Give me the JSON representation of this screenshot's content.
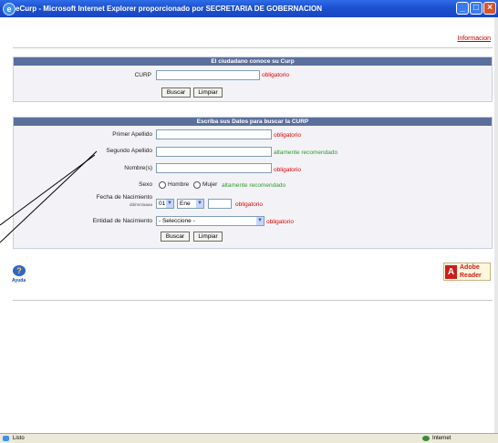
{
  "window": {
    "title": "eCurp - Microsoft Internet Explorer proporcionado por SECRETARIA DE GOBERNACION",
    "minimize": "_",
    "maximize": "□",
    "close": "×"
  },
  "header_link": "Informacion",
  "section1": {
    "title": "El ciudadano conoce su Curp",
    "curp_label": "CURP",
    "curp_value": "",
    "curp_note": "obligatorio",
    "search_button": "Buscar",
    "clear_button": "Limpiar"
  },
  "section2": {
    "title": "Escriba sus Datos para buscar la CURP",
    "first_surname_label": "Primer Apellido",
    "first_surname_note": "obligatorio",
    "second_surname_label": "Segundo Apellido",
    "second_surname_note": "altamente recomendado",
    "names_label": "Nombre(s)",
    "names_note": "obligatorio",
    "sex_label": "Sexo",
    "sex_options": [
      "Hombre",
      "Mujer"
    ],
    "sex_note": "altamente recomendado",
    "birthdate_label": "Fecha de Nacimiento",
    "birthdate_format": "dd/mm/aaaa",
    "day_value": "01",
    "month_value": "Ene",
    "year_value": "",
    "birthdate_note": "obligatorio",
    "birthplace_label": "Entidad de Nacimiento",
    "birthplace_value": "- Seleccione -",
    "birthplace_note": "obligatorio",
    "search_button": "Buscar",
    "clear_button": "Limpiar"
  },
  "help_label": "Ayuda",
  "adobe": {
    "logo_letter": "A",
    "line1": "Adobe",
    "line2": "Reader"
  },
  "statusbar": {
    "left": "Listo",
    "right": "Internet"
  },
  "colors": {
    "titlebar": "#1c4fcf",
    "panel_header": "#5b6f9c",
    "required": "#e00000",
    "recommended": "#2d9a2d"
  },
  "icons": [
    "ie-icon",
    "help-icon",
    "adobe-reader-icon",
    "internet-zone-icon"
  ]
}
